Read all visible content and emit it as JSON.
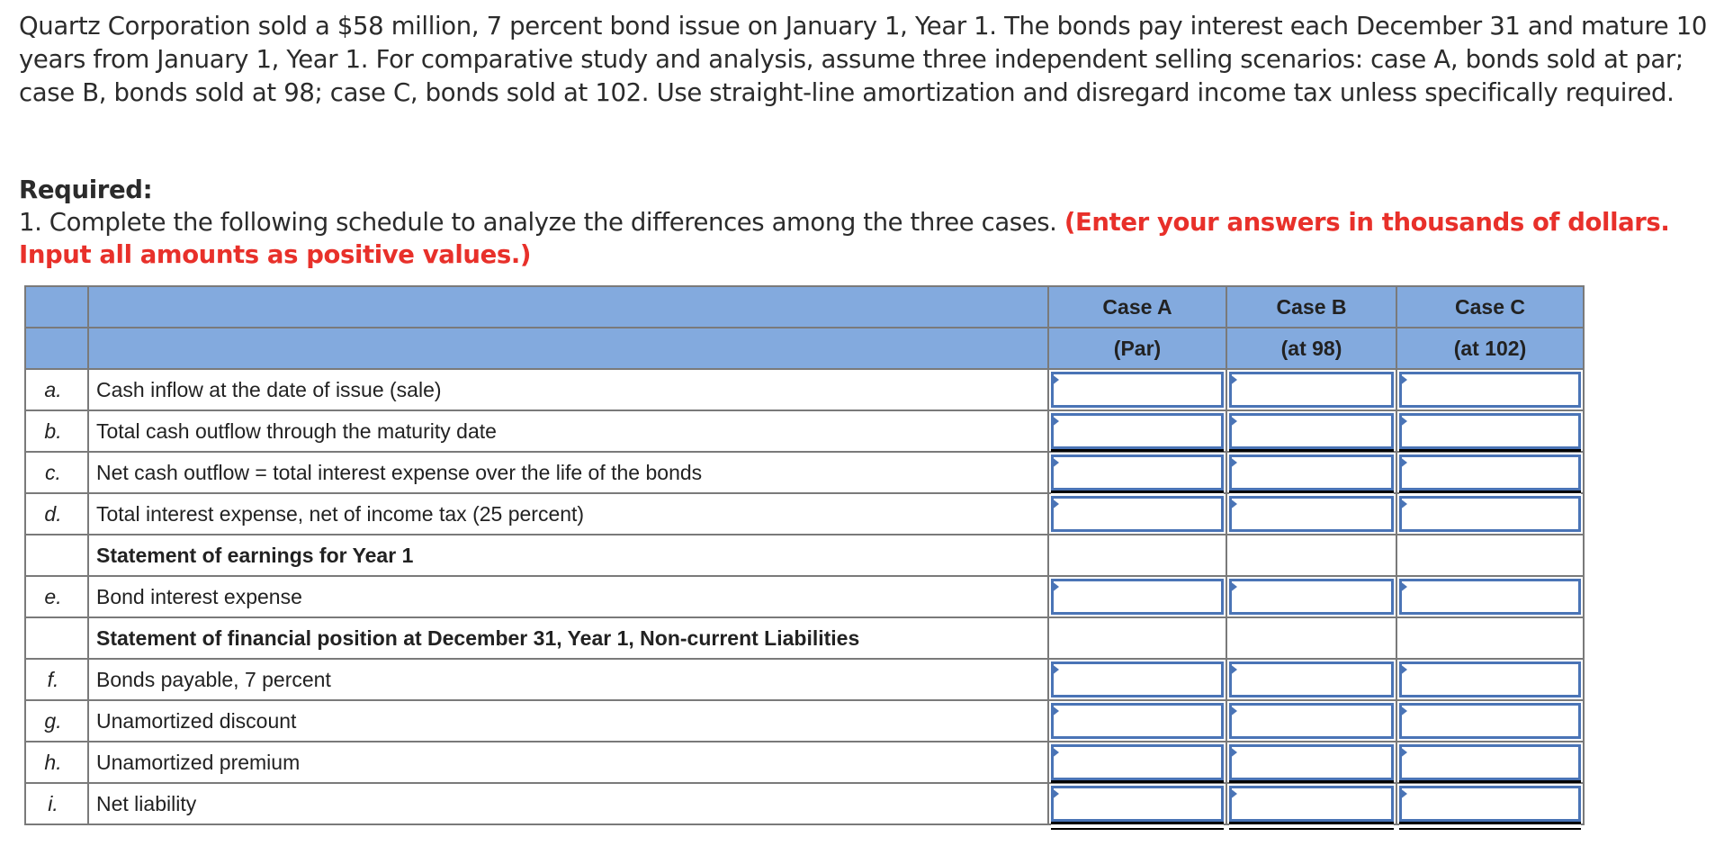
{
  "problem": {
    "intro": "Quartz Corporation sold a $58 million, 7 percent bond issue on January 1, Year 1. The bonds pay interest each December 31 and mature 10 years from January 1, Year 1. For comparative study and analysis, assume three independent selling scenarios: case A, bonds sold at par; case B, bonds sold at 98; case C, bonds sold at 102. Use straight-line amortization and disregard income tax unless specifically required.",
    "required_heading": "Required:",
    "required_text": "1. Complete the following schedule to analyze the differences among the three cases. ",
    "required_note": "(Enter your answers in thousands of dollars. Input all amounts as positive values.)",
    "note_color": "#e8302a"
  },
  "schedule": {
    "header_color": "#83aade",
    "columns": [
      {
        "title": "Case A",
        "subtitle": "(Par)"
      },
      {
        "title": "Case B",
        "subtitle": "(at 98)"
      },
      {
        "title": "Case C",
        "subtitle": "(at 102)"
      }
    ],
    "rows": [
      {
        "letter": "a.",
        "label": "Cash inflow at the date of issue (sale)",
        "inputs": [
          "",
          "",
          ""
        ]
      },
      {
        "letter": "b.",
        "label": "Total cash outflow through the maturity date",
        "inputs": [
          "",
          "",
          ""
        ]
      },
      {
        "letter": "c.",
        "label": "Net cash outflow = total interest expense over the life of the bonds",
        "inputs": [
          "",
          "",
          ""
        ]
      },
      {
        "letter": "d.",
        "label": "Total interest expense, net of income tax (25 percent)",
        "inputs": [
          "",
          "",
          ""
        ]
      },
      {
        "letter": "",
        "label": "Statement of earnings for Year 1"
      },
      {
        "letter": "e.",
        "label": "Bond interest expense",
        "inputs": [
          "",
          "",
          ""
        ]
      },
      {
        "letter": "",
        "label": "Statement of financial position at December 31, Year 1, Non-current Liabilities"
      },
      {
        "letter": "f.",
        "label": "Bonds payable, 7 percent",
        "inputs": [
          "",
          "",
          ""
        ]
      },
      {
        "letter": "g.",
        "label": "Unamortized discount",
        "inputs": [
          "",
          "",
          ""
        ]
      },
      {
        "letter": "h.",
        "label": "Unamortized premium",
        "inputs": [
          "",
          "",
          ""
        ]
      },
      {
        "letter": "i.",
        "label": "Net liability",
        "inputs": [
          "",
          "",
          ""
        ]
      }
    ]
  }
}
